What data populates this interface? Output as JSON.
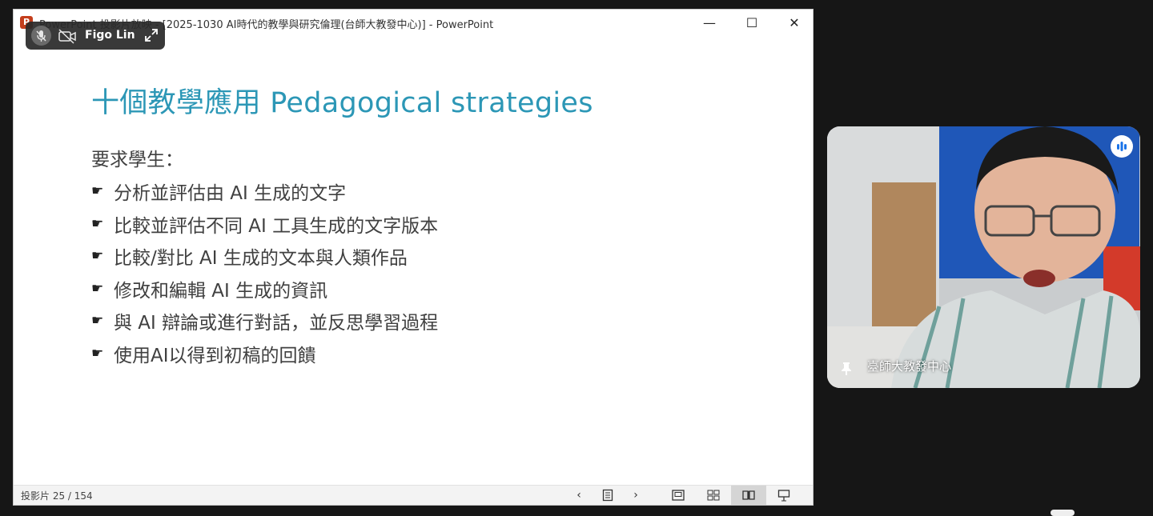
{
  "window": {
    "icon_letter": "P",
    "title": "PowerPoint 投影片放映 - [2025-1030 AI時代的教學與研究倫理(台師大教發中心)] - PowerPoint",
    "minimize_glyph": "—",
    "maximize_glyph": "☐",
    "close_glyph": "✕"
  },
  "participant": {
    "name": "Figo Lin"
  },
  "slide": {
    "title": "十個教學應用 Pedagogical strategies",
    "intro": "要求學生：",
    "bullet_marker": "☛",
    "bullets": [
      "分析並評估由 AI 生成的文字",
      "比較並評估不同 AI 工具生成的文字版本",
      "比較/對比 AI 生成的文本與人類作品",
      "修改和編輯 AI 生成的資訊",
      "與 AI 辯論或進行對話，並反思學習過程",
      "使用AI以得到初稿的回饋"
    ]
  },
  "statusbar": {
    "slide_counter": "投影片 25 / 154",
    "prev_glyph": "‹",
    "next_glyph": "›"
  },
  "video": {
    "name": "臺師大教發中心"
  },
  "colors": {
    "title_blue": "#2c97b6",
    "body_text": "#404040",
    "background": "#161616"
  }
}
